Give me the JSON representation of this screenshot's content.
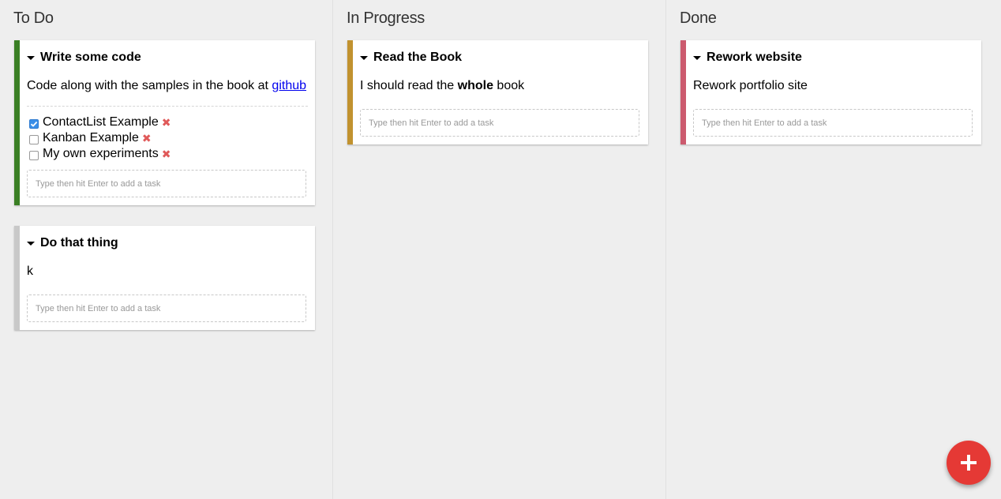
{
  "columns": [
    {
      "title": "To Do",
      "cards": [
        {
          "title": "Write some code",
          "description": "Code along with the samples in the book at",
          "link_text": "github",
          "color": "#3a7f24",
          "tasks": [
            {
              "name": "ContactList Example",
              "done": true
            },
            {
              "name": "Kanban Example",
              "done": false
            },
            {
              "name": "My own experiments",
              "done": false
            }
          ]
        },
        {
          "title": "Do that thing",
          "description": "k",
          "color": "#c8c8c8",
          "tasks": []
        }
      ]
    },
    {
      "title": "In Progress",
      "cards": [
        {
          "title": "Read the Book",
          "desc_before": "I should read the ",
          "desc_bold": "whole",
          "desc_after": " book",
          "color": "#c1922f",
          "tasks": []
        }
      ]
    },
    {
      "title": "Done",
      "cards": [
        {
          "title": "Rework website",
          "description": "Rework portfolio site",
          "color": "#cc5a6e",
          "tasks": []
        }
      ]
    }
  ],
  "add_task_placeholder": "Type then hit Enter to add a task",
  "remove_glyph": "✖",
  "fab": {
    "icon": "plus-icon",
    "color": "#e53935"
  }
}
